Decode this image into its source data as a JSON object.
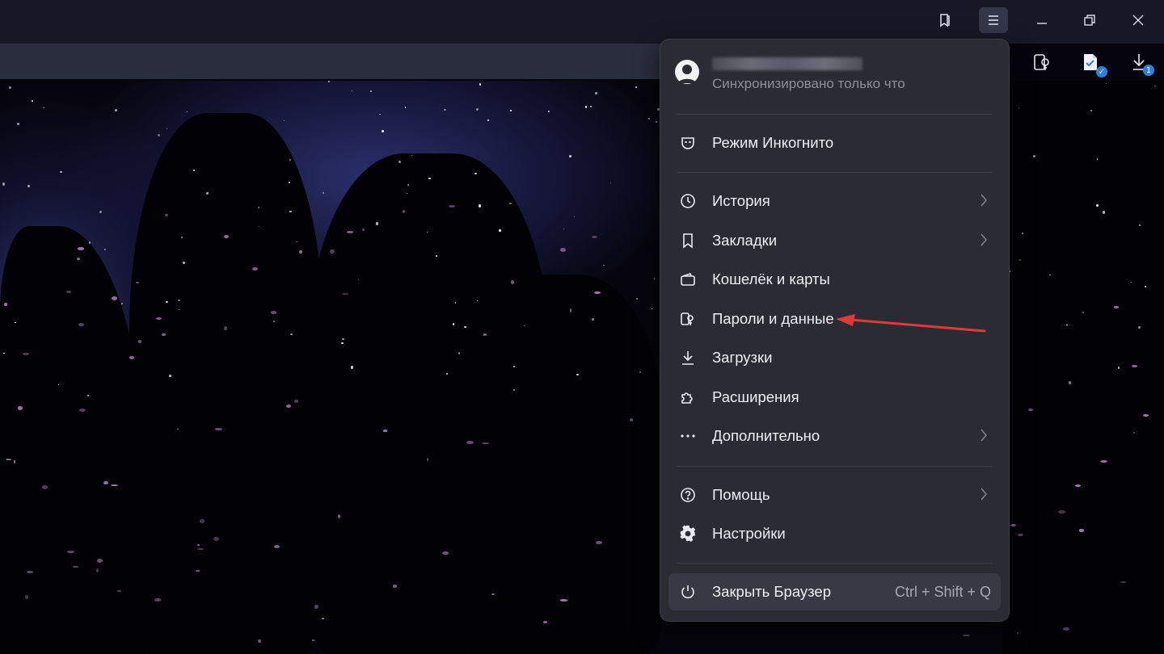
{
  "titlebar": {
    "icons": [
      "bookmarks-panel-icon",
      "hamburger-menu-icon",
      "minimize-icon",
      "restore-icon",
      "close-icon"
    ]
  },
  "toolbar": {
    "extensions": [
      "passwords-extension-icon",
      "document-verified-icon",
      "downloads-icon"
    ],
    "downloads_badge": "1"
  },
  "menu": {
    "profile": {
      "sync_status": "Синхронизировано только что"
    },
    "incognito": "Режим Инкогнито",
    "items": [
      {
        "label": "История",
        "icon": "clock-icon",
        "submenu": true
      },
      {
        "label": "Закладки",
        "icon": "bookmark-icon",
        "submenu": true
      },
      {
        "label": "Кошелёк и карты",
        "icon": "wallet-icon",
        "submenu": false
      },
      {
        "label": "Пароли и данные",
        "icon": "key-icon",
        "submenu": false
      },
      {
        "label": "Загрузки",
        "icon": "download-icon",
        "submenu": false
      },
      {
        "label": "Расширения",
        "icon": "puzzle-icon",
        "submenu": false
      },
      {
        "label": "Дополнительно",
        "icon": "more-dots-icon",
        "submenu": true
      }
    ],
    "help": "Помощь",
    "settings": "Настройки",
    "close_browser": "Закрыть Браузер",
    "close_shortcut": "Ctrl + Shift + Q"
  },
  "colors": {
    "menu_bg": "#2b2b33",
    "titlebar_bg": "#161825",
    "annotation_arrow": "#e03a3a",
    "badge": "#2f7fe0"
  }
}
